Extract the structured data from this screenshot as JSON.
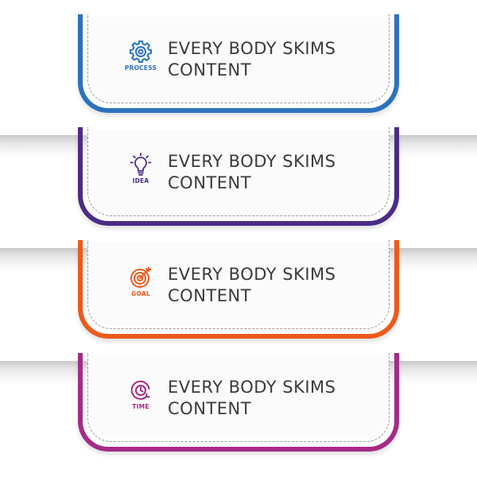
{
  "cards": [
    {
      "icon": "gear-icon",
      "label": "PROCESS",
      "line1": "EVERY BODY SKIMS",
      "line2": "CONTENT",
      "color": "#2d72bf"
    },
    {
      "icon": "lightbulb-icon",
      "label": "IDEA",
      "line1": "EVERY BODY SKIMS",
      "line2": "CONTENT",
      "color": "#4a2c86"
    },
    {
      "icon": "target-icon",
      "label": "GOAL",
      "line1": "EVERY BODY SKIMS",
      "line2": "CONTENT",
      "color": "#ec5a1c"
    },
    {
      "icon": "clock-icon",
      "label": "TIME",
      "line1": "EVERY BODY SKIMS",
      "line2": "CONTENT",
      "color": "#a52b86"
    }
  ]
}
